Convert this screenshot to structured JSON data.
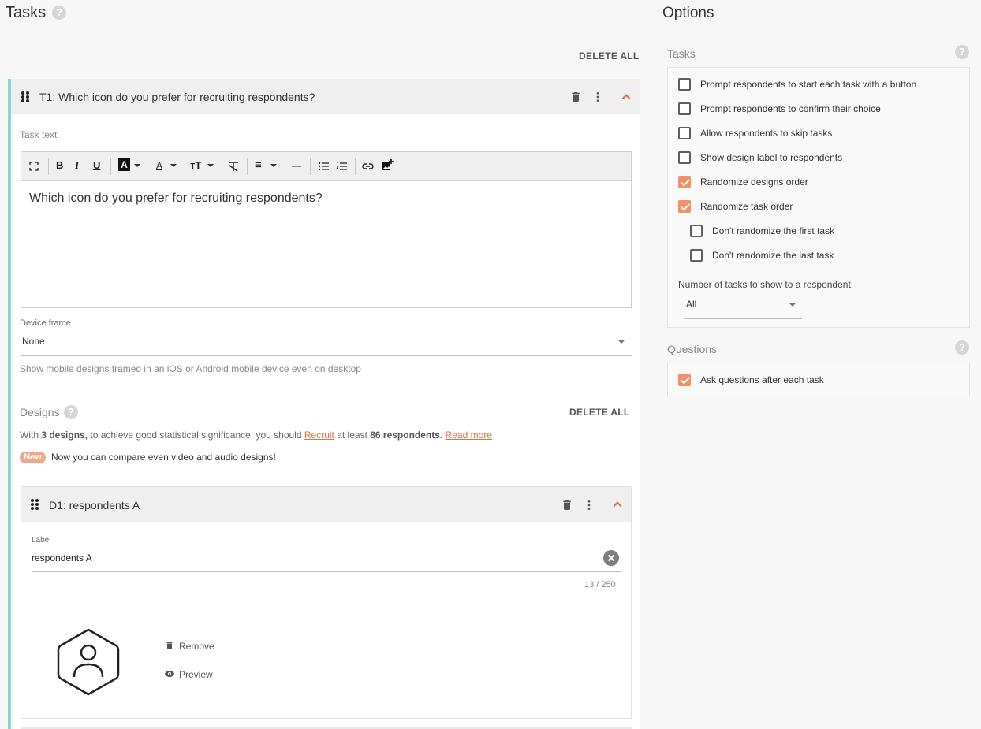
{
  "tasks_section": {
    "title": "Tasks",
    "delete_all": "DELETE ALL"
  },
  "task": {
    "title": "T1: Which icon do you prefer for recruiting respondents?",
    "task_text_label": "Task text",
    "editor_content": "Which icon do you prefer for recruiting respondents?",
    "toolbar": {
      "bold": "B",
      "italic": "I",
      "underline": "U",
      "highlight": "A",
      "font_color": "A",
      "font_size": "ᴛT",
      "align": "≡",
      "hr": "—"
    },
    "device_frame": {
      "label": "Device frame",
      "value": "None",
      "hint": "Show mobile designs framed in an iOS or Android mobile device even on desktop"
    },
    "designs": {
      "title": "Designs",
      "delete_all": "DELETE ALL",
      "info_prefix": "With ",
      "info_count": "3 designs,",
      "info_middle": " to achieve good statistical significance, you should ",
      "info_link_recruit": "Recruit",
      "info_middle2": " at least ",
      "info_respondents": "86 respondents.",
      "info_space": " ",
      "info_link_read_more": "Read more",
      "new_badge": "New",
      "new_text": "Now you can compare even video and audio designs!"
    },
    "design_item": {
      "title": "D1: respondents A",
      "label_caption": "Label",
      "label_value": "respondents A",
      "char_count": "13 / 250",
      "remove": "Remove",
      "preview": "Preview"
    }
  },
  "options": {
    "title": "Options",
    "tasks_panel": {
      "title": "Tasks",
      "items": [
        {
          "label": "Prompt respondents to start each task with a button",
          "checked": false
        },
        {
          "label": "Prompt respondents to confirm their choice",
          "checked": false
        },
        {
          "label": "Allow respondents to skip tasks",
          "checked": false
        },
        {
          "label": "Show design label to respondents",
          "checked": false
        },
        {
          "label": "Randomize designs order",
          "checked": true
        },
        {
          "label": "Randomize task order",
          "checked": true
        },
        {
          "label": "Don't randomize the first task",
          "checked": false
        },
        {
          "label": "Don't randomize the last task",
          "checked": false
        }
      ],
      "num_tasks_label": "Number of tasks to show to a respondent:",
      "num_tasks_value": "All"
    },
    "questions_panel": {
      "title": "Questions",
      "items": [
        {
          "label": "Ask questions after each task",
          "checked": true
        }
      ]
    }
  },
  "colors": {
    "accent": "#f0916a",
    "task_border": "#8cd4cc"
  }
}
